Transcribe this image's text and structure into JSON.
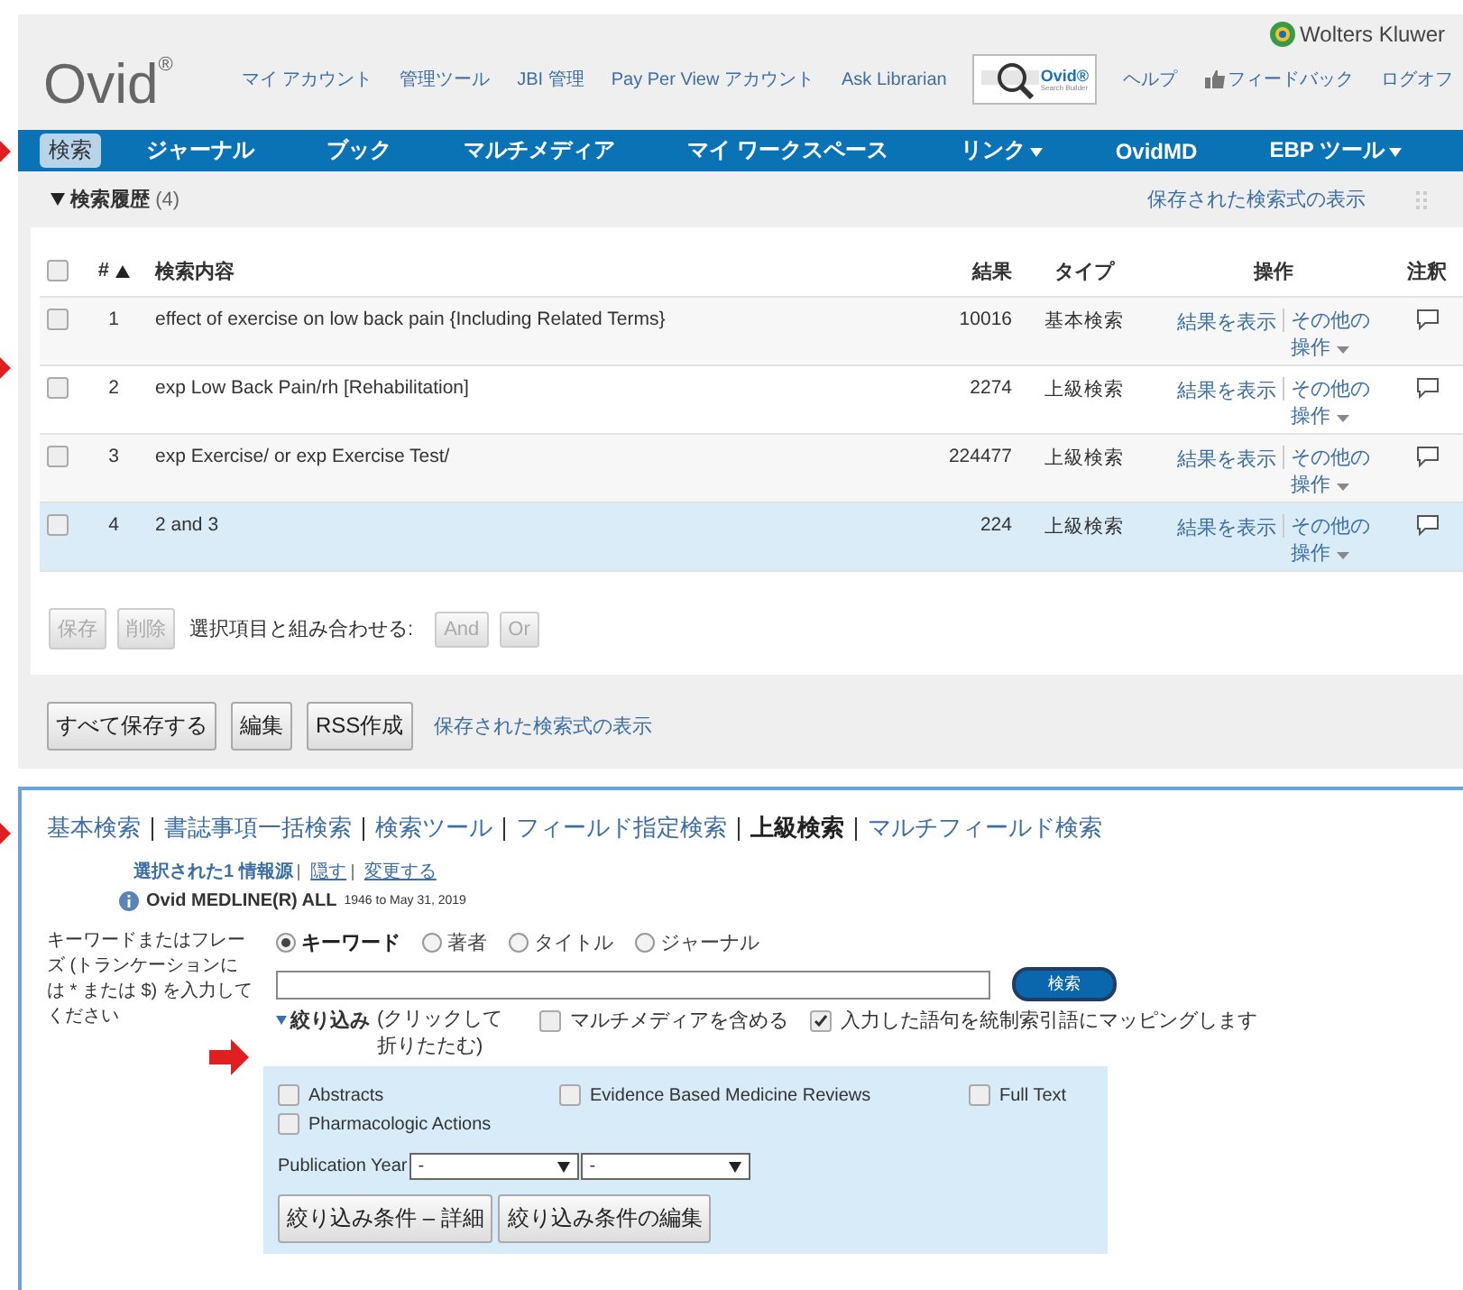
{
  "header": {
    "logo": "Ovid",
    "logo_mark": "®",
    "links": [
      "マイ アカウント",
      "管理ツール",
      "JBI 管理",
      "Pay Per View アカウント",
      "Ask Librarian"
    ],
    "builder_badge": {
      "title": "Ovid®",
      "subtitle": "Search Builder"
    },
    "brand": "Wolters Kluwer",
    "right_links": [
      {
        "label": "ヘルプ",
        "kind": "plain"
      },
      {
        "label": "フィードバック",
        "kind": "thumb"
      },
      {
        "label": "ログオフ",
        "kind": "plain"
      }
    ]
  },
  "nav": [
    {
      "label": "検索",
      "selected": true,
      "dropdown": false
    },
    {
      "label": "ジャーナル",
      "selected": false,
      "dropdown": false
    },
    {
      "label": "ブック",
      "selected": false,
      "dropdown": false
    },
    {
      "label": "マルチメディア",
      "selected": false,
      "dropdown": false
    },
    {
      "label": "マイ ワークスペース",
      "selected": false,
      "dropdown": false
    },
    {
      "label": "リンク",
      "selected": false,
      "dropdown": true
    },
    {
      "label": "OvidMD",
      "selected": false,
      "dropdown": false
    },
    {
      "label": "EBP ツール",
      "selected": false,
      "dropdown": true
    }
  ],
  "history": {
    "title": "検索履歴",
    "count": "(4)",
    "expanded": true,
    "all_checked": false,
    "saved_link": "保存された検索式の表示",
    "columns": {
      "number": "#",
      "query": "検索内容",
      "results": "結果",
      "type": "タイプ",
      "actions": "操作",
      "notes": "注釈"
    },
    "rows": [
      {
        "checked": false,
        "selected": false,
        "number": "1",
        "query": "effect of exercise on low back pain {Including Related Terms}",
        "results": "10016",
        "type": "基本検索",
        "view": "結果を表示",
        "more": "その他の操作"
      },
      {
        "checked": false,
        "selected": false,
        "number": "2",
        "query": "exp Low Back Pain/rh [Rehabilitation]",
        "results": "2274",
        "type": "上級検索",
        "view": "結果を表示",
        "more": "その他の操作"
      },
      {
        "checked": false,
        "selected": false,
        "number": "3",
        "query": "exp Exercise/ or exp Exercise Test/",
        "results": "224477",
        "type": "上級検索",
        "view": "結果を表示",
        "more": "その他の操作"
      },
      {
        "checked": false,
        "selected": true,
        "number": "4",
        "query": "2 and 3",
        "results": "224",
        "type": "上級検索",
        "view": "結果を表示",
        "more": "その他の操作"
      }
    ],
    "row_buttons": [
      {
        "label": "保存",
        "disabled": true
      },
      {
        "label": "削除",
        "disabled": true
      }
    ],
    "combine_label": "選択項目と組み合わせる:",
    "combine_buttons": [
      {
        "label": "And",
        "disabled": true
      },
      {
        "label": "Or",
        "disabled": true
      }
    ],
    "footer_buttons": [
      "すべて保存する",
      "編集",
      "RSS作成"
    ],
    "footer_link": "保存された検索式の表示"
  },
  "search": {
    "tabs": [
      {
        "label": "基本検索",
        "selected": false
      },
      {
        "label": "書誌事項一括検索",
        "selected": false
      },
      {
        "label": "検索ツール",
        "selected": false
      },
      {
        "label": "フィールド指定検索",
        "selected": false
      },
      {
        "label": "上級検索",
        "selected": true
      },
      {
        "label": "マルチフィールド検索",
        "selected": false
      }
    ],
    "source_label": "選択された1 情報源",
    "source_links": [
      "隠す",
      "変更する"
    ],
    "database": "Ovid MEDLINE(R) ALL",
    "database_range": "1946 to May 31, 2019",
    "field_label": "キーワードまたはフレーズ (トランケーションには * または $) を入力してください",
    "modes": [
      {
        "label": "キーワード",
        "selected": true
      },
      {
        "label": "著者",
        "selected": false
      },
      {
        "label": "タイトル",
        "selected": false
      },
      {
        "label": "ジャーナル",
        "selected": false
      }
    ],
    "search_button": "検索",
    "limits_toggle": "絞り込み",
    "limits_hint": "(クリックして折りたたむ)",
    "limits_expanded": true,
    "options": [
      {
        "label": "マルチメディアを含める",
        "checked": false
      },
      {
        "label": "入力した語句を統制索引語にマッピングします",
        "checked": true
      }
    ],
    "limits": [
      {
        "label": "Abstracts",
        "checked": false
      },
      {
        "label": "Evidence Based Medicine Reviews",
        "checked": false
      },
      {
        "label": "Full Text",
        "checked": false
      },
      {
        "label": "Pharmacologic Actions",
        "checked": false
      }
    ],
    "year_label": "Publication Year",
    "year_from": "-",
    "year_to": "-",
    "limit_buttons": [
      "絞り込み条件 – 詳細",
      "絞り込み条件の編集"
    ]
  }
}
